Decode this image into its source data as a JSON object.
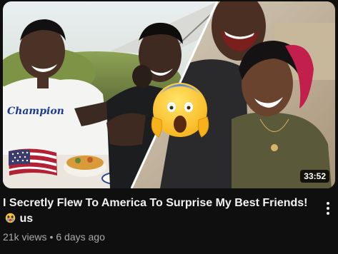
{
  "video": {
    "title": "I Secretly Flew To America To Surprise My Best Friends!",
    "title_suffix": "us",
    "views": "21k views",
    "separator": "•",
    "age": "6 days ago",
    "duration": "33:52"
  },
  "thumbnail": {
    "shirt_text": "Champion",
    "icons": [
      "usa-flag-icon",
      "screaming-emoji-icon"
    ]
  },
  "icons": {
    "more_menu": "more-vertical-icon",
    "title_emoji": "crying-emoji-icon"
  },
  "colors": {
    "background": "#0f0f0f",
    "title": "#f1f1f1",
    "secondary_text": "#aaaaaa"
  }
}
